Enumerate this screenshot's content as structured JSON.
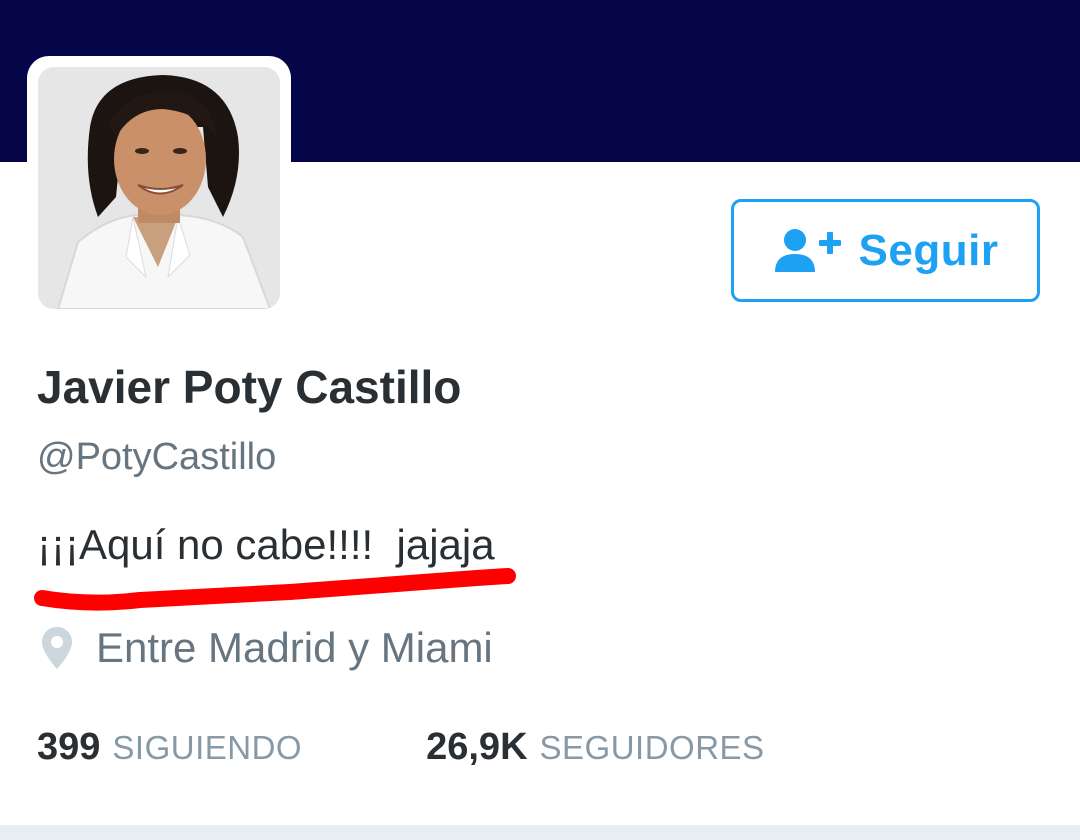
{
  "profile": {
    "display_name": "Javier Poty Castillo",
    "handle": "@PotyCastillo",
    "bio": "¡¡¡Aquí no cabe!!!!  jajaja",
    "location": "Entre Madrid y Miami"
  },
  "actions": {
    "follow_label": "Seguir",
    "follow_icon": "add-user-icon"
  },
  "stats": {
    "following_count": "399",
    "following_label": "SIGUIENDO",
    "followers_count": "26,9K",
    "followers_label": "SEGUIDORES"
  },
  "icons": {
    "location": "map-pin-icon"
  },
  "colors": {
    "banner": "#05054a",
    "accent": "#1da1f2",
    "text_primary": "#292f33",
    "text_secondary": "#66757f",
    "annotation": "#ff0000"
  }
}
